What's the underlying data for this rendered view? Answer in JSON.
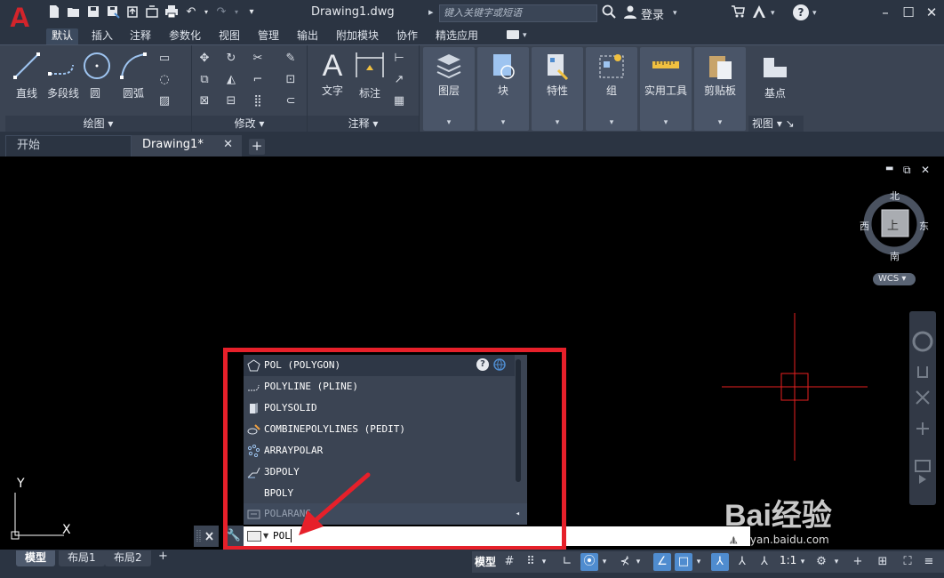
{
  "titlebar": {
    "document": "Drawing1.dwg",
    "search_placeholder": "键入关键字或短语",
    "login": "登录"
  },
  "ribbon_tabs": [
    "默认",
    "插入",
    "注释",
    "参数化",
    "视图",
    "管理",
    "输出",
    "附加模块",
    "协作",
    "精选应用"
  ],
  "draw_panel": {
    "tools": [
      "直线",
      "多段线",
      "圆",
      "圆弧"
    ],
    "footer": "绘图 ▾"
  },
  "modify_panel": {
    "footer": "修改 ▾"
  },
  "annotation_panel": {
    "tools": [
      "文字",
      "标注"
    ],
    "footer": "注释 ▾"
  },
  "button_panels": [
    "图层",
    "块",
    "特性",
    "组",
    "实用工具",
    "剪贴板"
  ],
  "view_panel": {
    "tool": "基点",
    "footer": "视图 ▾ ↘"
  },
  "doc_tabs": {
    "start": "开始",
    "active": "Drawing1*",
    "close": "✕",
    "add": "+"
  },
  "viewcube": {
    "north": "北",
    "south": "南",
    "east": "东",
    "west": "西",
    "face": "上",
    "wcs": "WCS"
  },
  "ucs": {
    "y": "Y",
    "x": "X"
  },
  "autocomplete": [
    {
      "label": "POL (POLYGON)",
      "icon": "polygon-icon"
    },
    {
      "label": "POLYLINE (PLINE)",
      "icon": "polyline-icon"
    },
    {
      "label": "POLYSOLID",
      "icon": "polysolid-icon"
    },
    {
      "label": "COMBINEPOLYLINES (PEDIT)",
      "icon": "combine-polylines-icon"
    },
    {
      "label": "ARRAYPOLAR",
      "icon": "array-polar-icon"
    },
    {
      "label": "3DPOLY",
      "icon": "3dpoly-icon"
    },
    {
      "label": "BPOLY",
      "icon": ""
    },
    {
      "label": "POLARANG",
      "icon": "system-variable-icon"
    }
  ],
  "command": {
    "text": "POL"
  },
  "layout_tabs": [
    "模型",
    "布局1",
    "布局2"
  ],
  "status": {
    "model": "模型",
    "scale": "1:1"
  },
  "watermark": {
    "logo": "Bai经验",
    "url": "jingyan.baidu.com"
  },
  "colors": {
    "crosshair": "#e81f1f",
    "highlight": "#e6202a",
    "accent": "#4f8ccf"
  }
}
